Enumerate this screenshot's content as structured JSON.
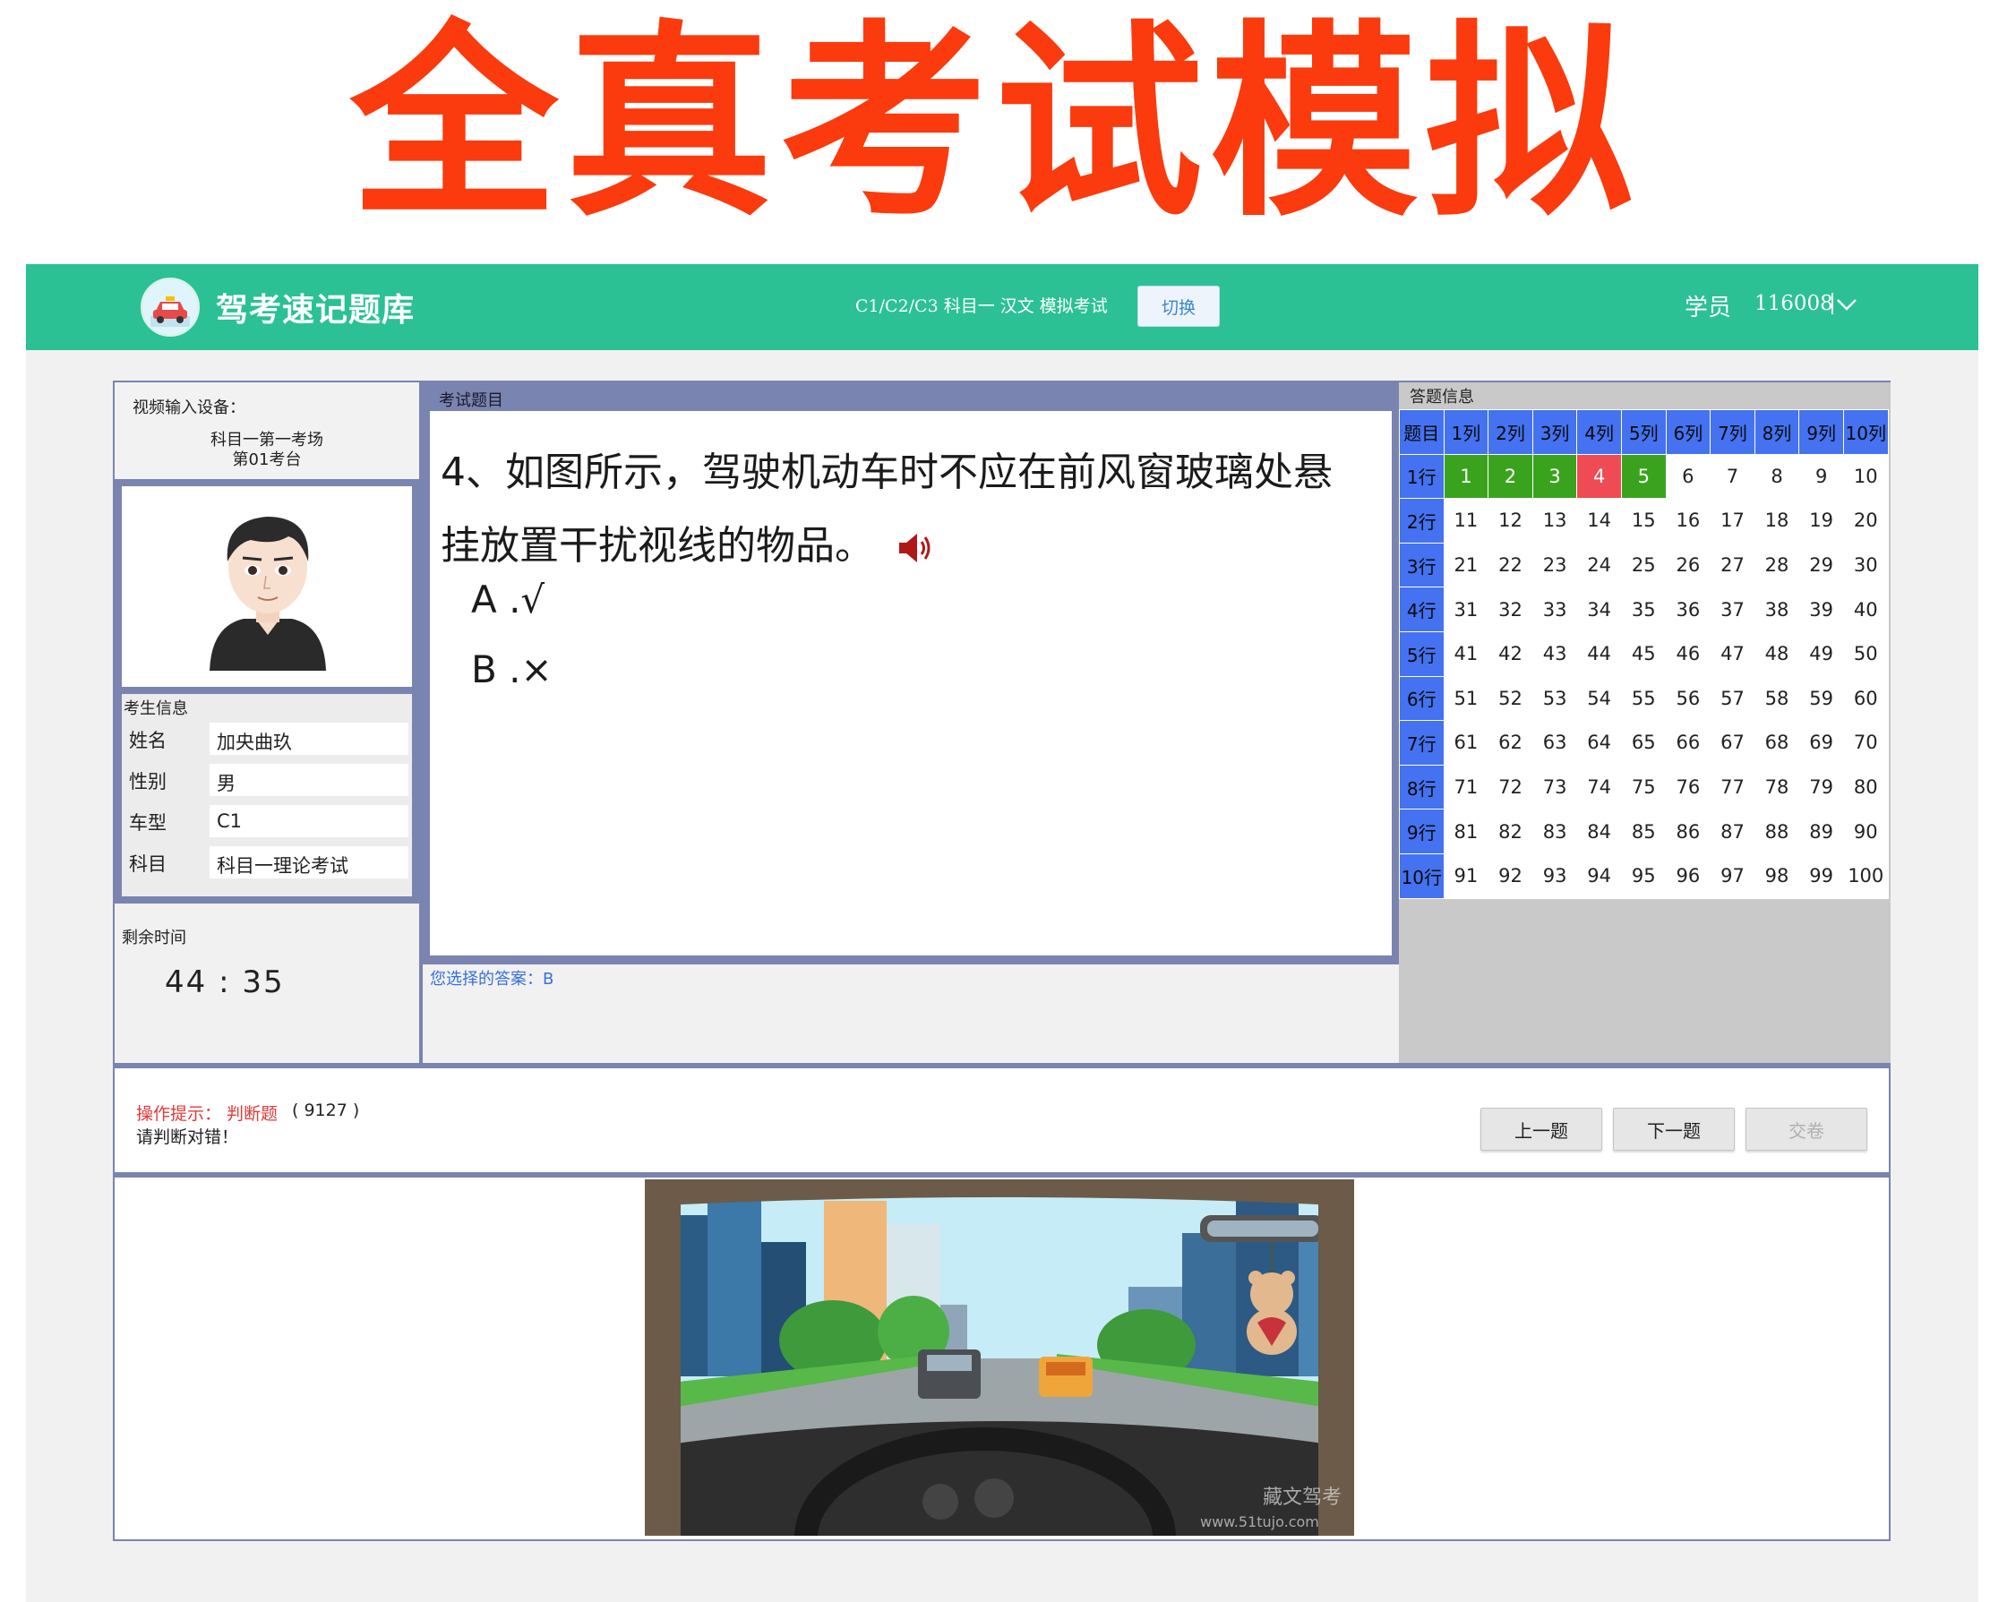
{
  "banner": {
    "title": "全真考试模拟"
  },
  "header": {
    "brand": "驾考速记题库",
    "exam_type": "C1/C2/C3 科目一 汉文 模拟考试",
    "switch_label": "切换",
    "user_role": "学员",
    "user_id": "116008",
    "logo_icon": "taxi-logo-icon",
    "color": "#2bc194"
  },
  "device": {
    "label": "视频输入设备：",
    "room": "科目一第一考场",
    "seat": "第01考台"
  },
  "candidate": {
    "title": "考生信息",
    "rows": [
      {
        "key": "姓名",
        "value": "加央曲玖"
      },
      {
        "key": "性别",
        "value": "男"
      },
      {
        "key": "车型",
        "value": "C1"
      },
      {
        "key": "科目",
        "value": "科目一理论考试"
      }
    ]
  },
  "timer": {
    "label": "剩余时间",
    "value": "44 : 35"
  },
  "question": {
    "header": "考试题目",
    "text": "4、如图所示，驾驶机动车时不应在前风窗玻璃处悬挂放置干扰视线的物品。",
    "options": [
      "A .√",
      "B .×"
    ],
    "selected": "您选择的答案：B"
  },
  "answer_grid": {
    "title": "答题信息",
    "corner": "题目",
    "columns": [
      "1列",
      "2列",
      "3列",
      "4列",
      "5列",
      "6列",
      "7列",
      "8列",
      "9列",
      "10列"
    ],
    "rows": [
      "1行",
      "2行",
      "3行",
      "4行",
      "5行",
      "6行",
      "7行",
      "8行",
      "9行",
      "10行"
    ],
    "correct": [
      1,
      2,
      3,
      5
    ],
    "wrong": [
      4
    ],
    "correct_color": "#3aa31e",
    "wrong_color": "#ee4b55",
    "header_color": "#4472f0"
  },
  "tip": {
    "label": "操作提示： 判断题",
    "code": "( 9127 )",
    "hint": "请判断对错！"
  },
  "buttons": {
    "prev": "上一题",
    "next": "下一题",
    "submit": "交卷"
  },
  "scene": {
    "watermark": "藏文驾考",
    "watermark_url": "www.51tujo.com"
  }
}
